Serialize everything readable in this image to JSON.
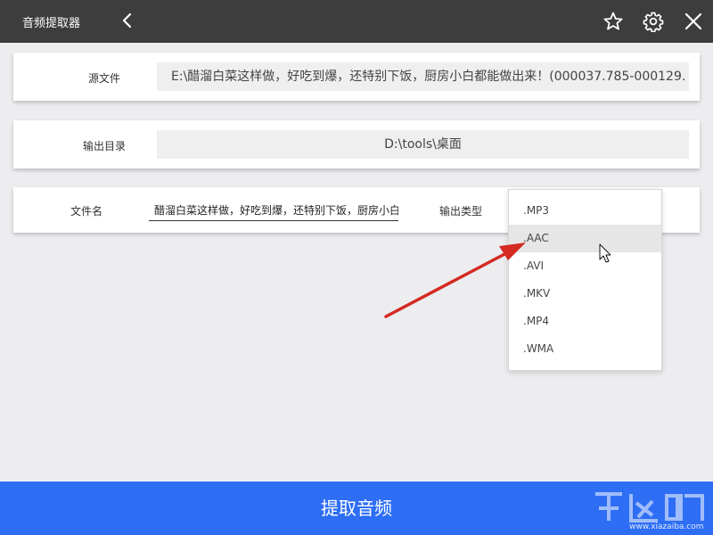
{
  "app": {
    "title": "音频提取器",
    "icons": {
      "back": "chevron-left-icon",
      "favorite": "star-icon",
      "settings": "gear-icon",
      "close": "close-icon"
    }
  },
  "source": {
    "label": "源文件",
    "value": "E:\\醋溜白菜这样做，好吃到爆，还特别下饭，厨房小白都能做出来！(000037.785-000129."
  },
  "output_dir": {
    "label": "输出目录",
    "value": "D:\\tools\\桌面"
  },
  "filename": {
    "label": "文件名",
    "value": "醋溜白菜这样做，好吃到爆，还特别下饭，厨房小白"
  },
  "output_type": {
    "label": "输出类型",
    "selected": ".AAC",
    "options": [
      ".MP3",
      ".AAC",
      ".AVI",
      ".MKV",
      ".MP4",
      ".WMA"
    ]
  },
  "extract_button": {
    "label": "提取音频"
  },
  "watermark": {
    "text": "www.xiazaiba.com"
  },
  "colors": {
    "titlebar": "#3d3d3d",
    "accent": "#2e6ef5",
    "arrow": "#d42a22"
  }
}
